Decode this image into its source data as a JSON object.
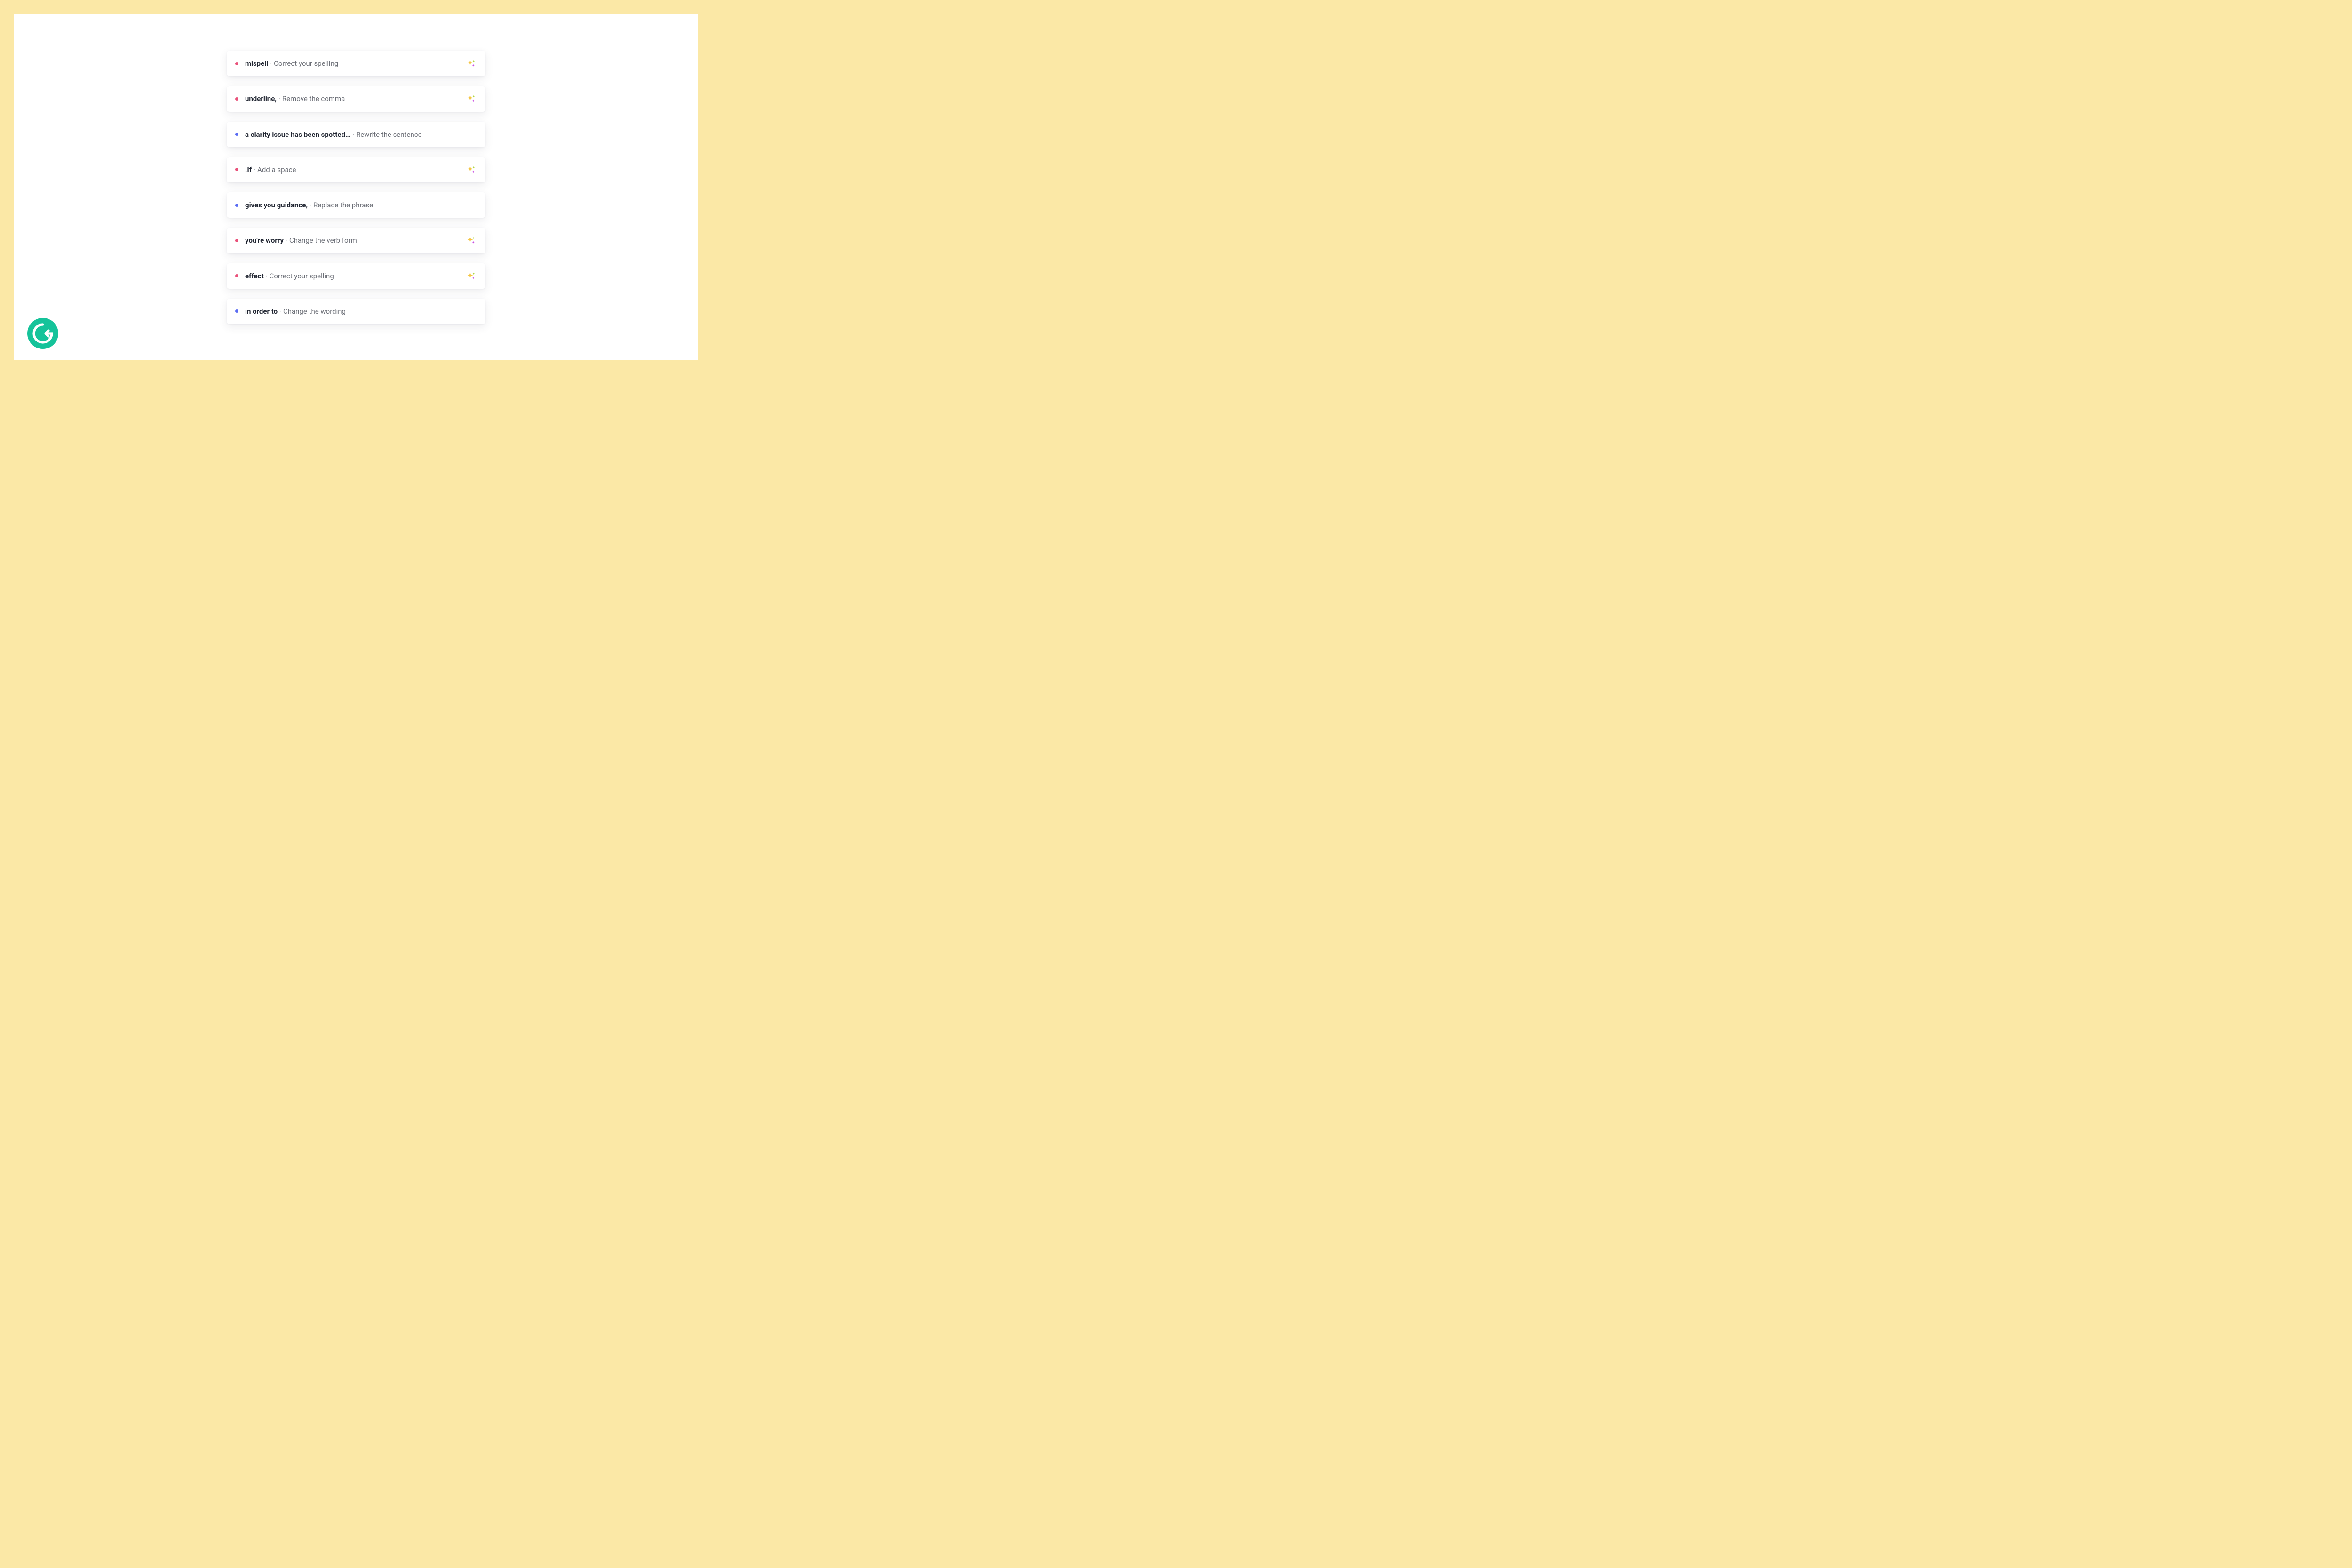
{
  "colors": {
    "frame": "#fbe8a6",
    "canvas": "#ffffff",
    "dot_red": "#e9517a",
    "dot_blue": "#5a6cf3",
    "logo": "#15c39a"
  },
  "separator": "·",
  "suggestions": [
    {
      "dot": "red",
      "term": "mispell",
      "action": "Correct your spelling",
      "sparkle": true
    },
    {
      "dot": "red",
      "term": "underline,",
      "action": "Remove the comma",
      "sparkle": true
    },
    {
      "dot": "blue",
      "term": "a clarity issue has been spotted…",
      "action": "Rewrite the sentence",
      "sparkle": false
    },
    {
      "dot": "red",
      "term": ".If",
      "action": "Add a space",
      "sparkle": true
    },
    {
      "dot": "blue",
      "term": "gives you guidance,",
      "action": "Replace the phrase",
      "sparkle": false
    },
    {
      "dot": "red",
      "term": "you're worry",
      "action": "Change the verb form",
      "sparkle": true
    },
    {
      "dot": "red",
      "term": "effect",
      "action": "Correct your spelling",
      "sparkle": true
    },
    {
      "dot": "blue",
      "term": "in order to",
      "action": "Change the wording",
      "sparkle": false
    }
  ]
}
